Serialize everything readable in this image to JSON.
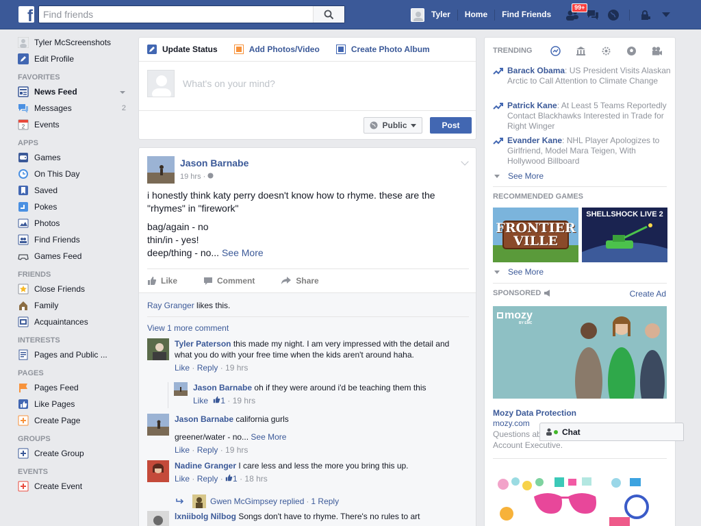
{
  "topbar": {
    "logo": "f",
    "search_placeholder": "Find friends",
    "user": "Tyler",
    "home": "Home",
    "find_friends": "Find Friends",
    "friend_requests_badge": "99+"
  },
  "sidebar": {
    "profile_name": "Tyler McScreenshots",
    "edit_profile": "Edit Profile",
    "sections": {
      "favorites": "FAVORITES",
      "apps": "APPS",
      "friends": "FRIENDS",
      "interests": "INTERESTS",
      "pages": "PAGES",
      "groups": "GROUPS",
      "events": "EVENTS"
    },
    "favorites": [
      {
        "label": "News Feed"
      },
      {
        "label": "Messages",
        "count": "2"
      },
      {
        "label": "Events"
      }
    ],
    "apps": [
      {
        "label": "Games"
      },
      {
        "label": "On This Day"
      },
      {
        "label": "Saved"
      },
      {
        "label": "Pokes"
      },
      {
        "label": "Photos"
      },
      {
        "label": "Find Friends"
      },
      {
        "label": "Games Feed"
      }
    ],
    "friends": [
      {
        "label": "Close Friends"
      },
      {
        "label": "Family"
      },
      {
        "label": "Acquaintances"
      }
    ],
    "interests": [
      {
        "label": "Pages and Public ..."
      }
    ],
    "pages": [
      {
        "label": "Pages Feed"
      },
      {
        "label": "Like Pages"
      },
      {
        "label": "Create Page"
      }
    ],
    "groups": [
      {
        "label": "Create Group"
      }
    ],
    "events": [
      {
        "label": "Create Event"
      }
    ],
    "calendar_day": "2"
  },
  "composer": {
    "tabs": [
      "Update Status",
      "Add Photos/Video",
      "Create Photo Album"
    ],
    "placeholder": "What's on your mind?",
    "privacy": "Public",
    "post": "Post"
  },
  "post": {
    "author": "Jason Barnabe",
    "time": "19 hrs",
    "text_1": "i honestly think katy perry doesn't know how to rhyme. these are the \"rhymes\" in \"firework\"",
    "text_2": "bag/again - no",
    "text_3": "thin/in - yes!",
    "text_4": "deep/thing - no...",
    "see_more": "See More",
    "actions": [
      "Like",
      "Comment",
      "Share"
    ],
    "likes_name": "Ray Granger",
    "likes_suffix": "likes this.",
    "view_more": "View 1 more comment",
    "comments": [
      {
        "name": "Tyler Paterson",
        "text": "this made my night. I am very impressed with the detail and what you do with your free time when the kids aren't around haha.",
        "like": "Like",
        "reply": "Reply",
        "time": "19 hrs"
      },
      {
        "name": "Jason Barnabe",
        "text": "oh if they were around i'd be teaching them this",
        "like": "Like",
        "likes": "1",
        "time": "19 hrs"
      },
      {
        "name": "Jason Barnabe",
        "text": "california gurls",
        "text_2": "greener/water - no...",
        "see_more": "See More",
        "like": "Like",
        "reply": "Reply",
        "time": "19 hrs"
      },
      {
        "name": "Nadine Granger",
        "text": "I care less and less the more you bring this up.",
        "like": "Like",
        "reply": "Reply",
        "likes": "1",
        "time": "18 hrs"
      },
      {
        "name": "lxniibolg Nilbog",
        "text": "Songs don't have to rhyme. There's no rules to art"
      }
    ],
    "replied": "Gwen McGimpsey replied",
    "replied_count": "1 Reply"
  },
  "right": {
    "trending_title": "TRENDING",
    "trending": [
      {
        "name": "Barack Obama",
        "text": ": US President Visits Alaskan Arctic to Call Attention to Climate Change"
      },
      {
        "name": "Patrick Kane",
        "text": ": At Least 5 Teams Reportedly Contact Blackhawks Interested in Trade for Right Winger"
      },
      {
        "name": "Evander Kane",
        "text": ": NHL Player Apologizes to Girlfriend, Model Mara Teigen, With Hollywood Billboard"
      }
    ],
    "see_more": "See More",
    "games_title": "RECOMMENDED GAMES",
    "games": [
      "FRONTIER VILLE",
      "SHELLSHOCK LIVE 2"
    ],
    "sponsored": "SPONSORED",
    "create_ad": "Create Ad",
    "ad_brand": "mozy",
    "ad_brand_sub": "BY EMC",
    "ad_title": "Mozy Data Protection",
    "ad_url": "mozy.com",
    "ad_text_1": "Questions ab",
    "ad_text_2": "Account Executive."
  },
  "chat": {
    "label": "Chat"
  },
  "colors": {
    "brand": "#3b5998",
    "post_button": "#4267b2",
    "badge": "#fa3e3e",
    "online": "#42b72a"
  }
}
